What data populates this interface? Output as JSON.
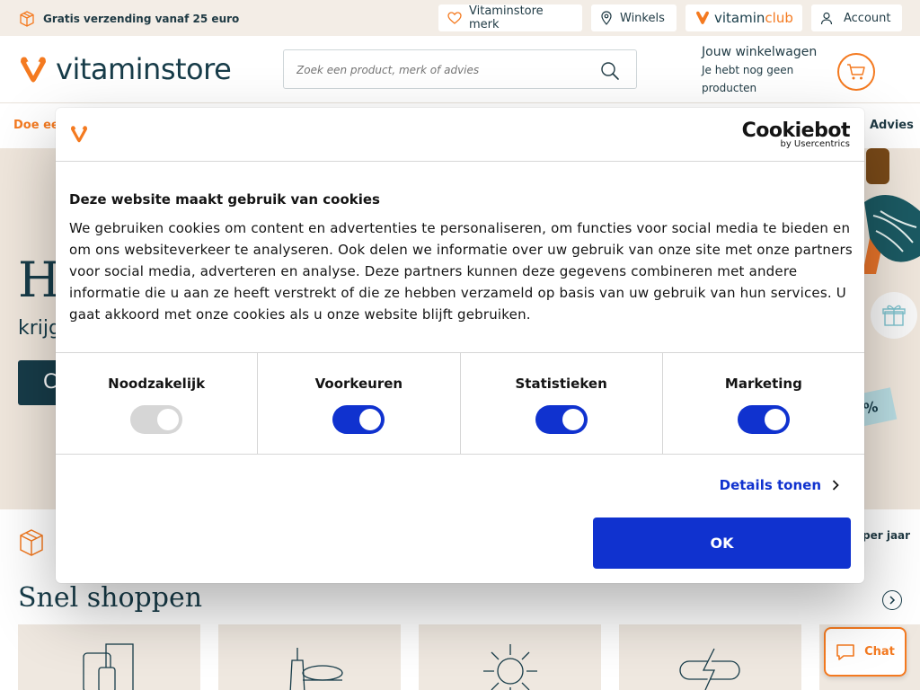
{
  "topbar": {
    "shipping_text": "Gratis verzending vanaf 25 euro",
    "links": [
      {
        "label": "Vitaminstore merk"
      },
      {
        "label": "Winkels"
      },
      {
        "label_a": "vitamin",
        "label_b": "club"
      },
      {
        "label": "Account"
      }
    ]
  },
  "header": {
    "logo_text": "vitaminstore",
    "search_placeholder": "Zoek een product, merk of advies",
    "cart_title": "Jouw winkelwagen",
    "cart_subtitle": "Je hebt nog geen producten"
  },
  "nav": {
    "left_label": "Doe een",
    "right_label": "Advies"
  },
  "hero": {
    "headline_fragment": "H",
    "sub_fragment": "krijg",
    "cta_fragment": "C",
    "ticket_fragment": "%"
  },
  "lower": {
    "usp_right": "per jaar",
    "section_title": "Snel shoppen",
    "chat_label": "Chat"
  },
  "cookie_dialog": {
    "brand": "Cookiebot",
    "brand_sub": "by Usercentrics",
    "title": "Deze website maakt gebruik van cookies",
    "body": "We gebruiken cookies om content en advertenties te personaliseren, om functies voor social media te bieden en om ons websiteverkeer te analyseren. Ook delen we informatie over uw gebruik van onze site met onze partners voor social media, adverteren en analyse. Deze partners kunnen deze gegevens combineren met andere informatie die u aan ze heeft verstrekt of die ze hebben verzameld op basis van uw gebruik van hun services. U gaat akkoord met onze cookies als u onze website blijft gebruiken.",
    "categories": [
      {
        "label": "Noodzakelijk",
        "enabled": true,
        "disabled": true
      },
      {
        "label": "Voorkeuren",
        "enabled": true,
        "disabled": false
      },
      {
        "label": "Statistieken",
        "enabled": true,
        "disabled": false
      },
      {
        "label": "Marketing",
        "enabled": true,
        "disabled": false
      }
    ],
    "details_label": "Details tonen",
    "ok_label": "OK"
  },
  "colors": {
    "brand_orange": "#f47a20",
    "brand_navy": "#173c49",
    "cookiebot_blue": "#1032cf",
    "hero_bg": "#efe6dc"
  }
}
